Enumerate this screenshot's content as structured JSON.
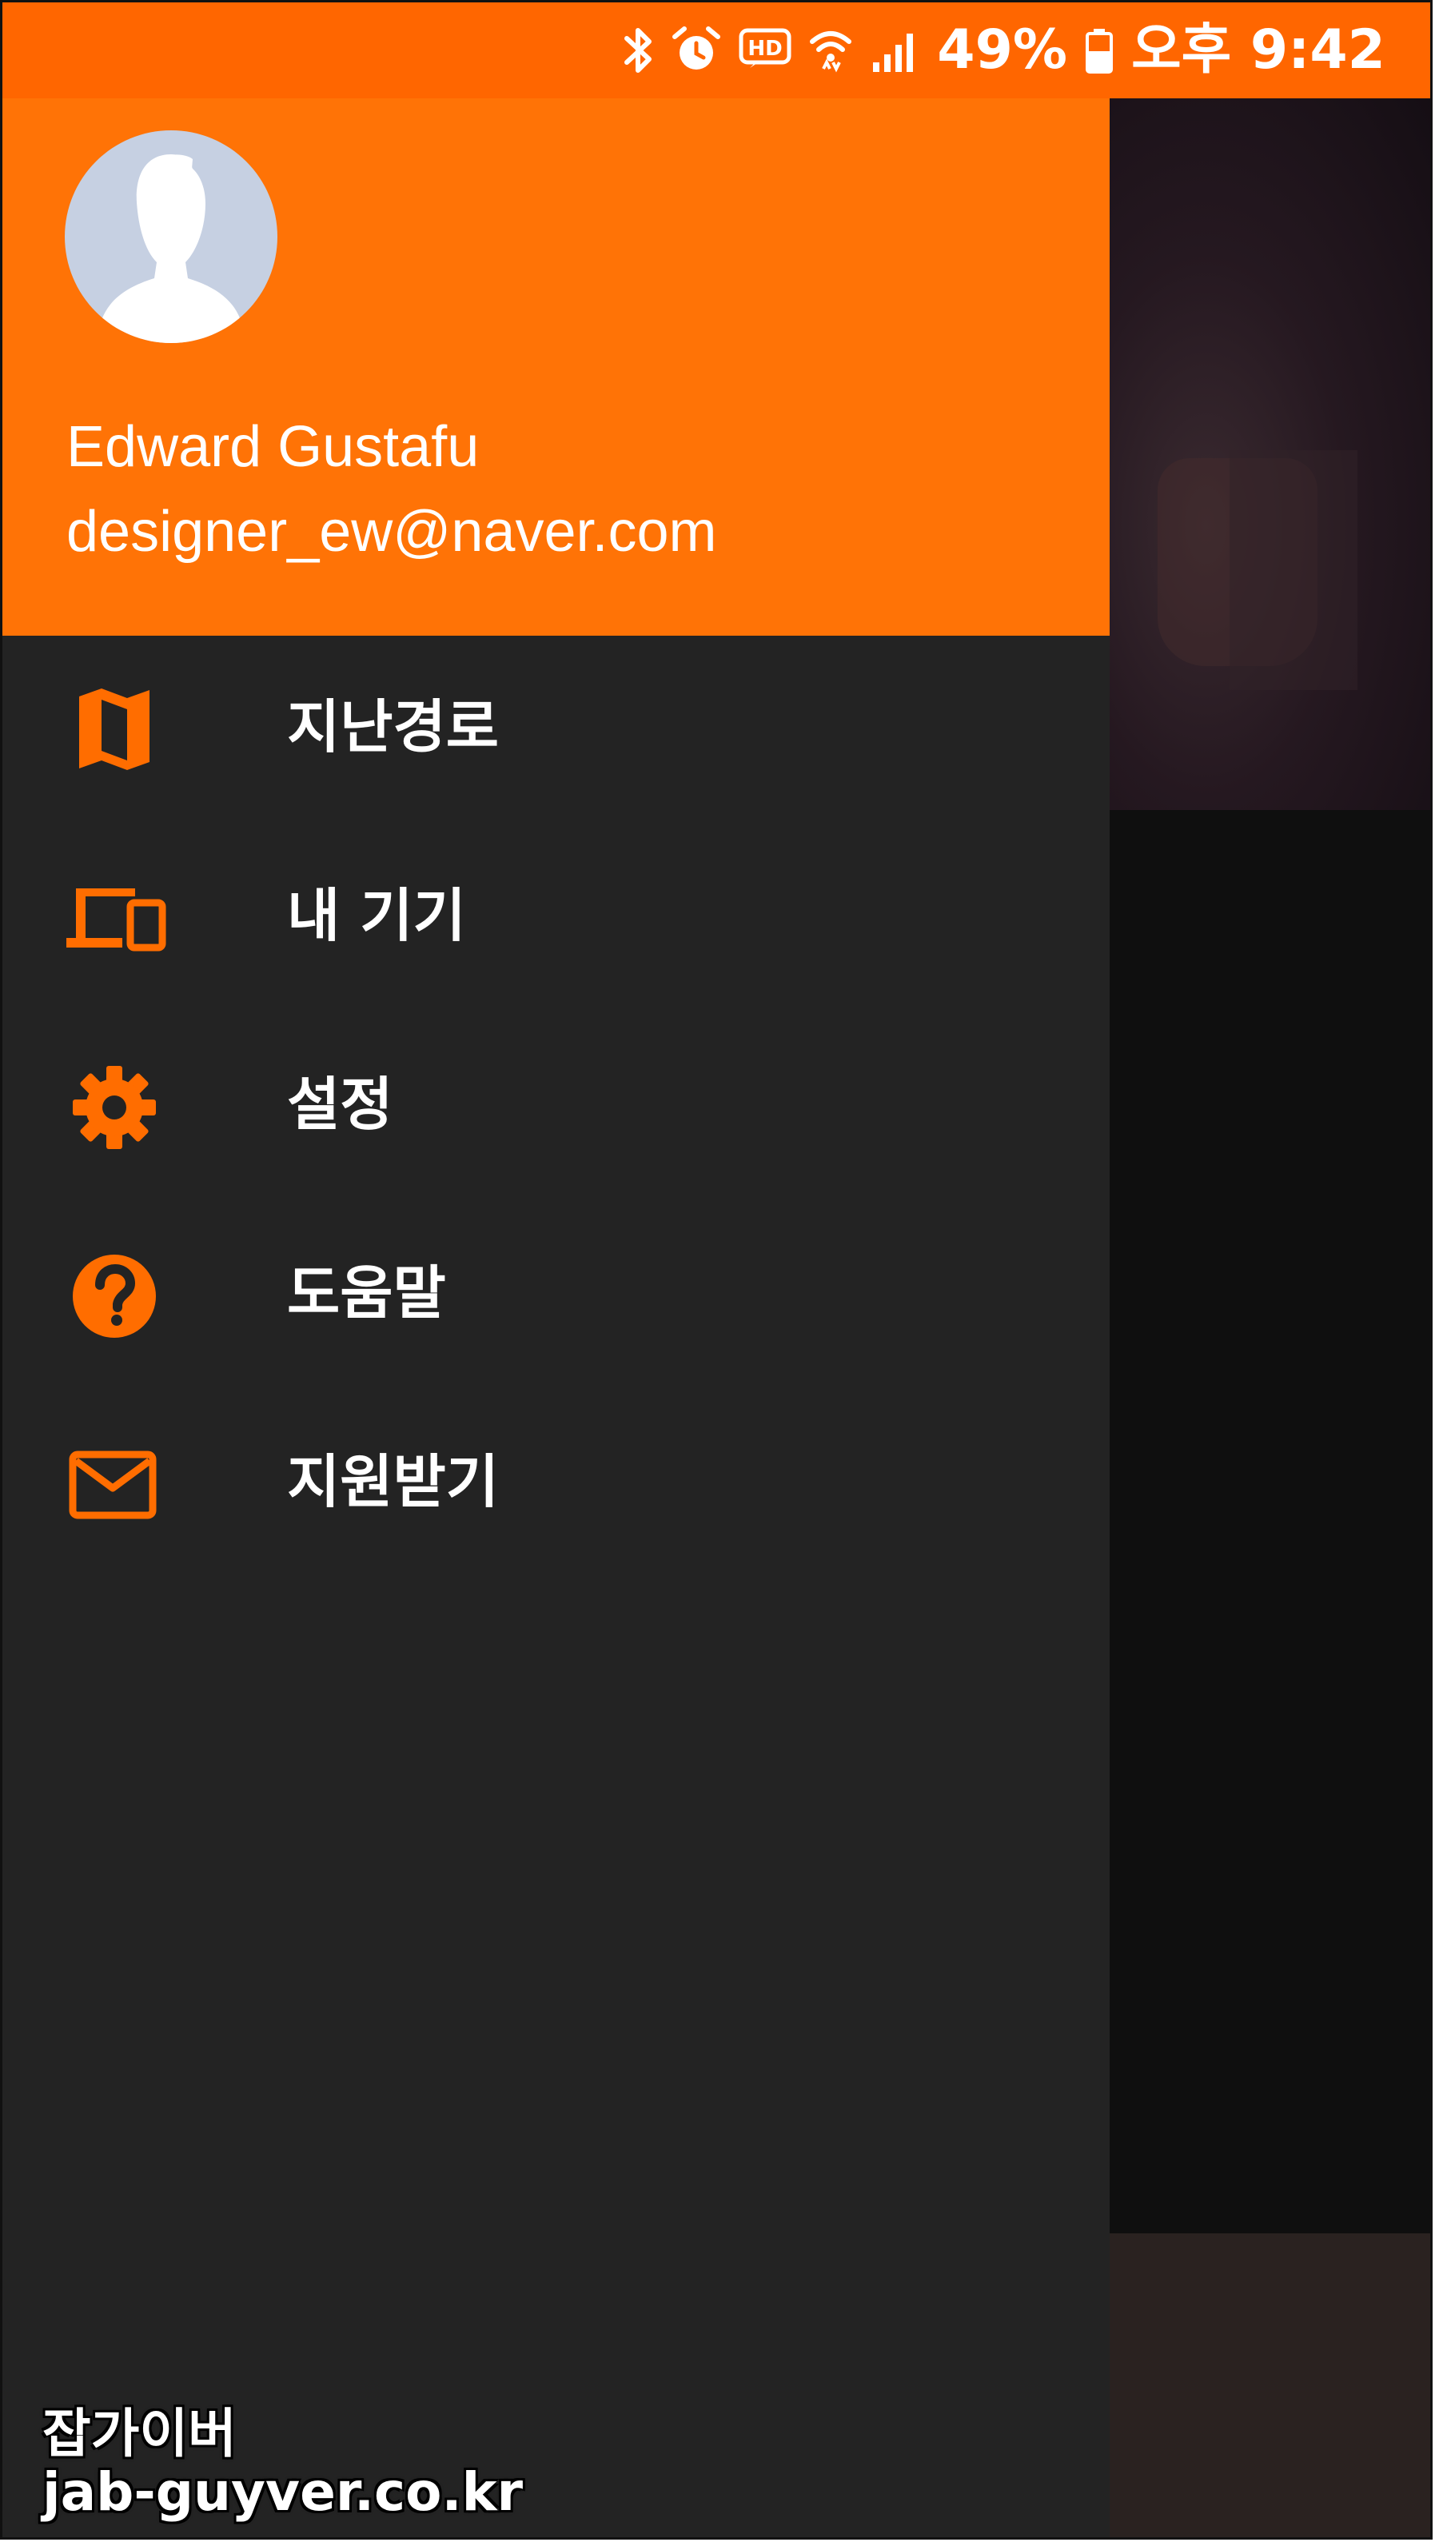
{
  "status_bar": {
    "battery_percent": "49%",
    "time": "오후 9:42",
    "icons": [
      "bluetooth-icon",
      "alarm-icon",
      "hd-voice-icon",
      "wifi-icon",
      "signal-icon",
      "battery-icon"
    ],
    "background_color": "#ff6600"
  },
  "drawer": {
    "header": {
      "user_name": "Edward Gustafu",
      "user_email": "designer_ew@naver.com",
      "background_color": "#ff7306"
    },
    "menu": {
      "items": [
        {
          "label": "지난경로",
          "icon": "map-icon"
        },
        {
          "label": "내 기기",
          "icon": "devices-icon"
        },
        {
          "label": "설정",
          "icon": "gear-icon"
        },
        {
          "label": "도움말",
          "icon": "help-icon"
        },
        {
          "label": "지원받기",
          "icon": "mail-icon"
        }
      ]
    },
    "accent_color": "#ff6d00",
    "background_color": "#232323"
  },
  "watermark": {
    "line1": "잡가이버",
    "line2": "jab-guyver.co.kr"
  }
}
